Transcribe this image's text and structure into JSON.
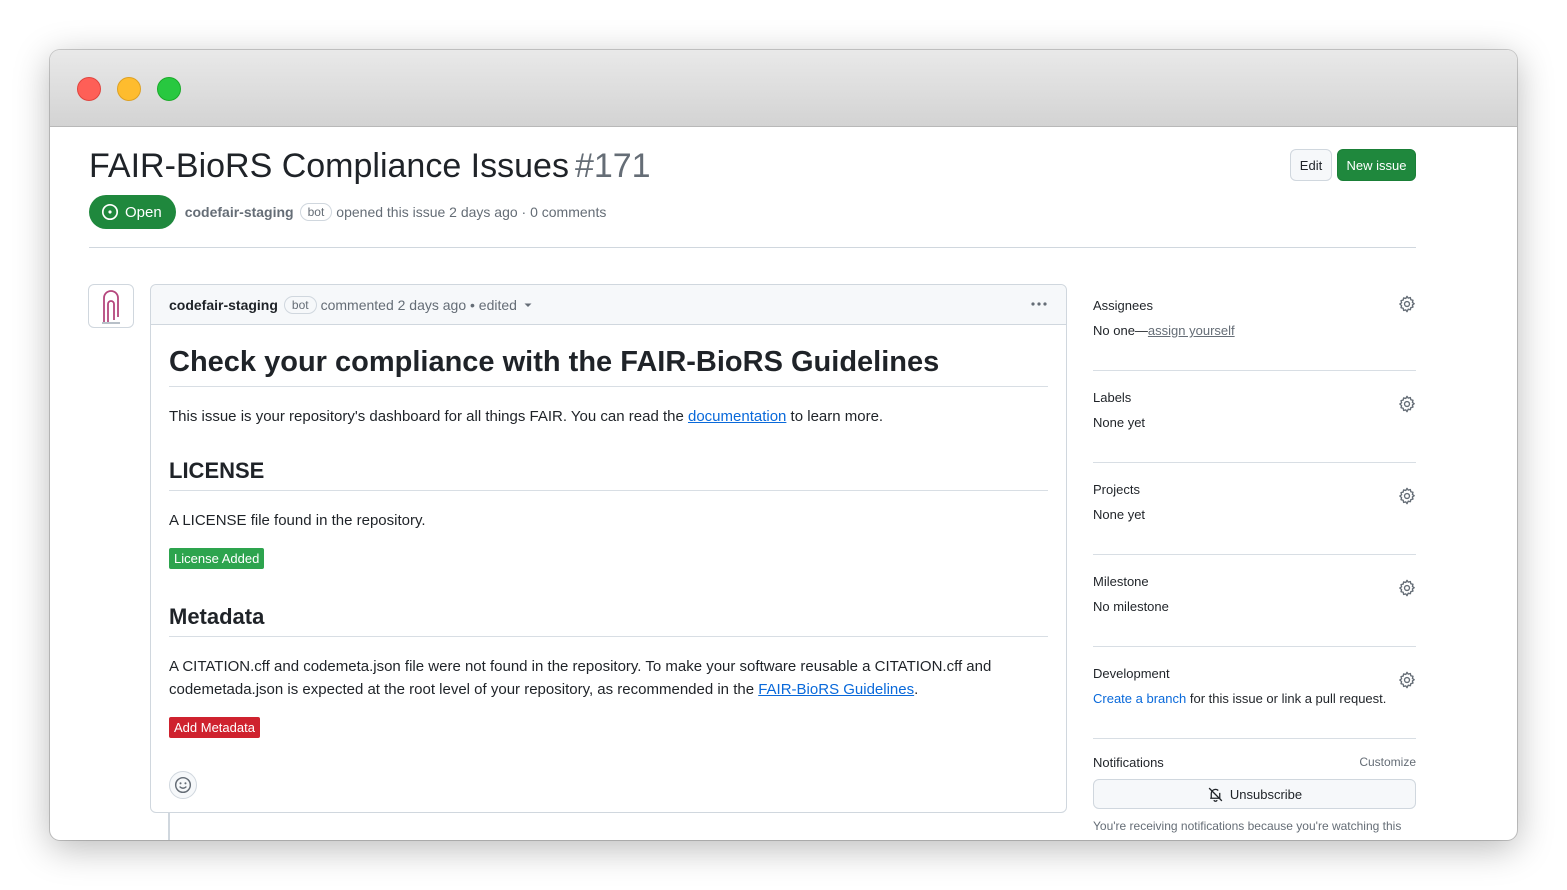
{
  "issue": {
    "title": "FAIR-BioRS Compliance Issues",
    "number": "#171",
    "state": "Open",
    "author": "codefair-staging",
    "author_badge": "bot",
    "meta_text": "opened this issue 2 days ago · 0 comments",
    "edit_label": "Edit",
    "new_issue_label": "New issue"
  },
  "comment": {
    "author": "codefair-staging",
    "author_badge": "bot",
    "meta_text": "commented 2 days ago • edited",
    "menu_icon": "kebab-horizontal-icon",
    "heading": "Check your compliance with the FAIR-BioRS Guidelines",
    "intro_before": "This issue is your repository's dashboard for all things FAIR. You can read the ",
    "intro_link": "documentation",
    "intro_after": " to learn more.",
    "license_heading": "LICENSE",
    "license_text": "A LICENSE file found in the repository.",
    "license_badge": "License Added",
    "metadata_heading": "Metadata",
    "metadata_text_before": "A CITATION.cff and codemeta.json file were not found in the repository. To make your software reusable a CITATION.cff and codemetada.json is expected at the root level of your repository, as recommended in the ",
    "metadata_link": "FAIR-BioRS Guidelines",
    "metadata_text_after": ".",
    "metadata_badge": "Add Metadata"
  },
  "sidebar": {
    "assignees": {
      "heading": "Assignees",
      "value_prefix": "No one—",
      "value_link": "assign yourself"
    },
    "labels": {
      "heading": "Labels",
      "value": "None yet"
    },
    "projects": {
      "heading": "Projects",
      "value": "None yet"
    },
    "milestone": {
      "heading": "Milestone",
      "value": "No milestone"
    },
    "development": {
      "heading": "Development",
      "link": "Create a branch",
      "suffix": " for this issue or link a pull request."
    },
    "notifications": {
      "heading": "Notifications",
      "customize": "Customize",
      "unsubscribe": "Unsubscribe",
      "note": "You're receiving notifications because you're watching this repository."
    }
  },
  "colors": {
    "open_green": "#1f883d",
    "link_blue": "#0969da",
    "badge_green": "#2da44e",
    "badge_red": "#cf222e"
  }
}
